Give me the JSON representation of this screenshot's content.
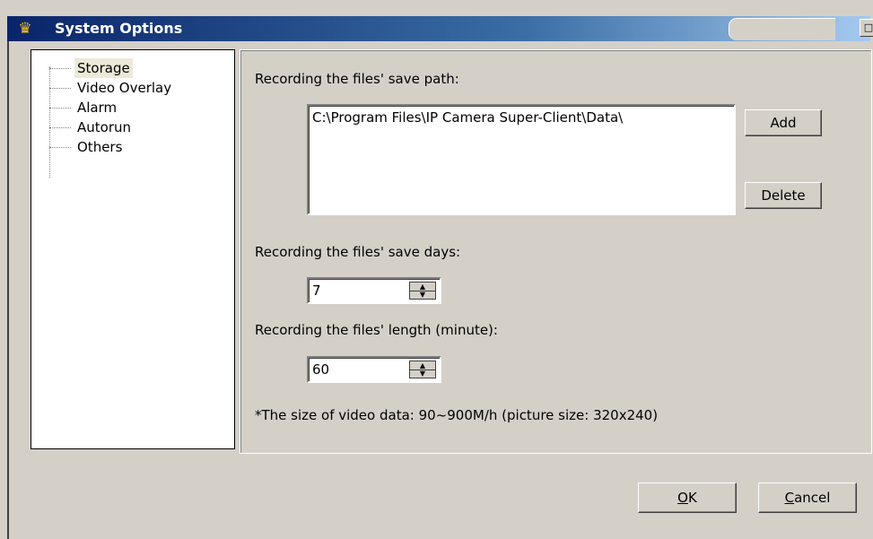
{
  "window": {
    "title": "System Options",
    "icon": "app-icon"
  },
  "tree": {
    "items": [
      {
        "label": "Storage",
        "selected": true
      },
      {
        "label": "Video Overlay"
      },
      {
        "label": "Alarm"
      },
      {
        "label": "Autorun"
      },
      {
        "label": "Others"
      }
    ]
  },
  "storage": {
    "save_path_label": "Recording the files' save path:",
    "paths": [
      "C:\\Program Files\\IP Camera Super-Client\\Data\\"
    ],
    "add_label": "Add",
    "delete_label": "Delete",
    "save_days_label": "Recording the files' save days:",
    "save_days_value": "7",
    "length_label": "Recording the files' length (minute):",
    "length_value": "60",
    "note": "*The size of video data: 90~900M/h (picture size: 320x240)"
  },
  "footer": {
    "ok_label": "K",
    "ok_mnemonic": "O",
    "cancel_label": "ancel",
    "cancel_mnemonic": "C"
  }
}
